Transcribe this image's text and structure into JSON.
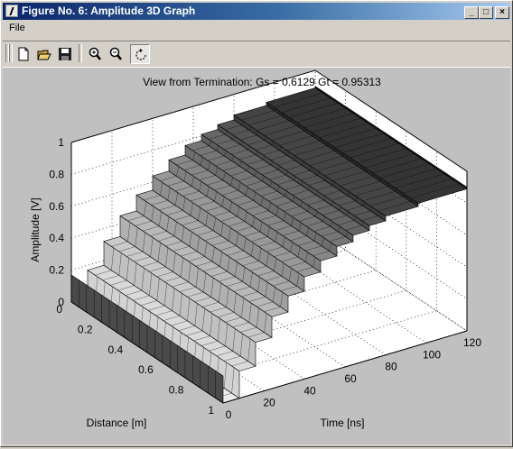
{
  "window": {
    "title": "Figure No. 6: Amplitude 3D Graph"
  },
  "controls": {
    "minimize": "_",
    "maximize": "□",
    "close": "×"
  },
  "menu": {
    "file": "File"
  },
  "toolbar": {
    "tools": [
      "new-file",
      "open-file",
      "save",
      "zoom-in",
      "zoom-out",
      "rotate"
    ],
    "active_tool": "rotate"
  },
  "chart_data": {
    "type": "surface-3d",
    "title": "View from Termination: Gs = 0.6129  Gt = 0.95313",
    "xlabel": "Distance [m]",
    "ylabel": "Time [ns]",
    "zlabel": "Amplitude [V]",
    "x_ticks": [
      "0",
      "0.2",
      "0.4",
      "0.6",
      "0.8",
      "1"
    ],
    "y_ticks": [
      "0",
      "20",
      "40",
      "60",
      "80",
      "100",
      "120"
    ],
    "z_ticks": [
      "0",
      "0.2",
      "0.4",
      "0.6",
      "0.8",
      "1"
    ],
    "xlim": [
      0,
      1
    ],
    "ylim": [
      0,
      120
    ],
    "zlim": [
      0,
      1
    ],
    "grid": true,
    "steps": [
      {
        "time": 0,
        "amplitude": 0.0
      },
      {
        "time": 8,
        "amplitude": 0.17
      },
      {
        "time": 16,
        "amplitude": 0.32
      },
      {
        "time": 24,
        "amplitude": 0.45
      },
      {
        "time": 32,
        "amplitude": 0.55
      },
      {
        "time": 40,
        "amplitude": 0.64
      },
      {
        "time": 48,
        "amplitude": 0.71
      },
      {
        "time": 56,
        "amplitude": 0.77
      },
      {
        "time": 64,
        "amplitude": 0.81
      },
      {
        "time": 72,
        "amplitude": 0.84
      },
      {
        "time": 80,
        "amplitude": 0.87
      },
      {
        "time": 96,
        "amplitude": 0.89
      },
      {
        "time": 120,
        "amplitude": 0.9
      }
    ]
  }
}
